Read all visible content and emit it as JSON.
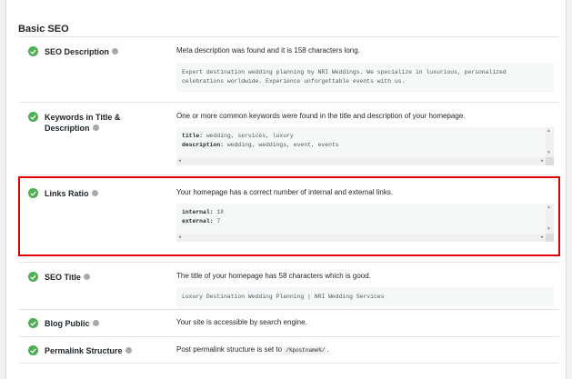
{
  "section_title": "Basic SEO",
  "rows": [
    {
      "label": "SEO Description",
      "message": "Meta description was found and it is 158 characters long.",
      "code_lines": [
        "Expert destination wedding planning by NRI Weddings. We specialize in luxurious, personalized",
        "celebrations worldwide. Experience unforgettable events with us."
      ]
    },
    {
      "label_line1": "Keywords in Title &",
      "label_line2": "Description",
      "message": "One or more common keywords were found in the title and description of your homepage.",
      "code": [
        {
          "key": "title:",
          "value": " wedding, services, luxury"
        },
        {
          "key": "description:",
          "value": " wedding, weddings, event, events"
        }
      ]
    },
    {
      "label": "Links Ratio",
      "message": "Your homepage has a correct number of internal and external links.",
      "code": [
        {
          "key": "internal:",
          "value": " 18"
        },
        {
          "key": "external:",
          "value": " 7"
        }
      ]
    },
    {
      "label": "SEO Title",
      "message": "The title of your homepage has 58 characters which is good.",
      "code_line": "Luxury Destination Wedding Planning | NRI Wedding Services"
    },
    {
      "label": "Blog Public",
      "message": "Your site is accessible by search engine."
    },
    {
      "label": "Permalink Structure",
      "message_prefix": "Post permalink structure is set to ",
      "message_code": "/%postname%/",
      "message_suffix": "."
    }
  ],
  "colors": {
    "success": "#4caf50",
    "highlight": "#e00000"
  },
  "icons": {
    "status": "check-circle-icon",
    "help": "help-icon"
  }
}
